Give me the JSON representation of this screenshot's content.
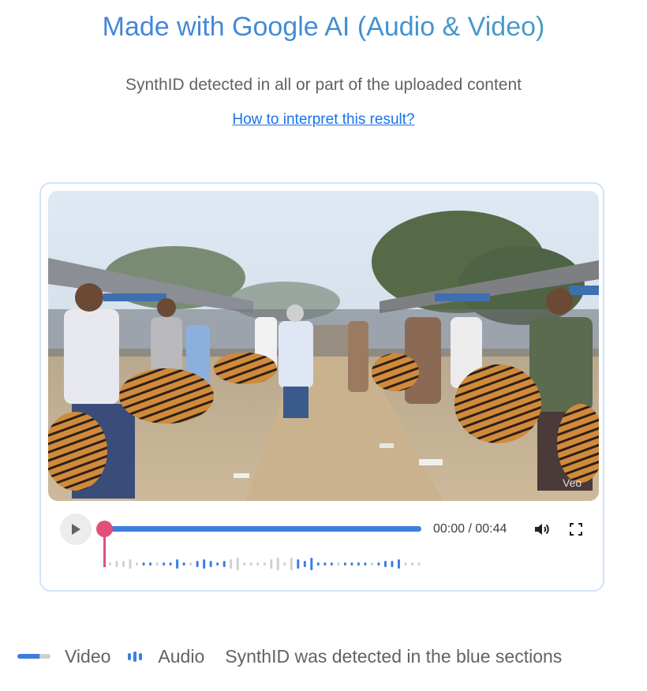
{
  "header": {
    "title": "Made with Google AI (Audio & Video)",
    "subtitle": "SynthID detected in all or part of the uploaded content",
    "help_link": "How to interpret this result?"
  },
  "player": {
    "current_time": "00:00",
    "duration": "00:44",
    "time_display": "00:00 / 00:44",
    "progress_fraction": 0.0,
    "watermark_text": "Veo",
    "icons": [
      "play-icon",
      "volume-icon",
      "fullscreen-icon"
    ]
  },
  "legend": {
    "video_label": "Video",
    "audio_label": "Audio",
    "note": "SynthID was detected in the blue sections"
  },
  "colors": {
    "detected": "#3d7fe0",
    "not_detected": "#d0d0d0",
    "playhead": "#e0517a",
    "link": "#1a73e8"
  }
}
